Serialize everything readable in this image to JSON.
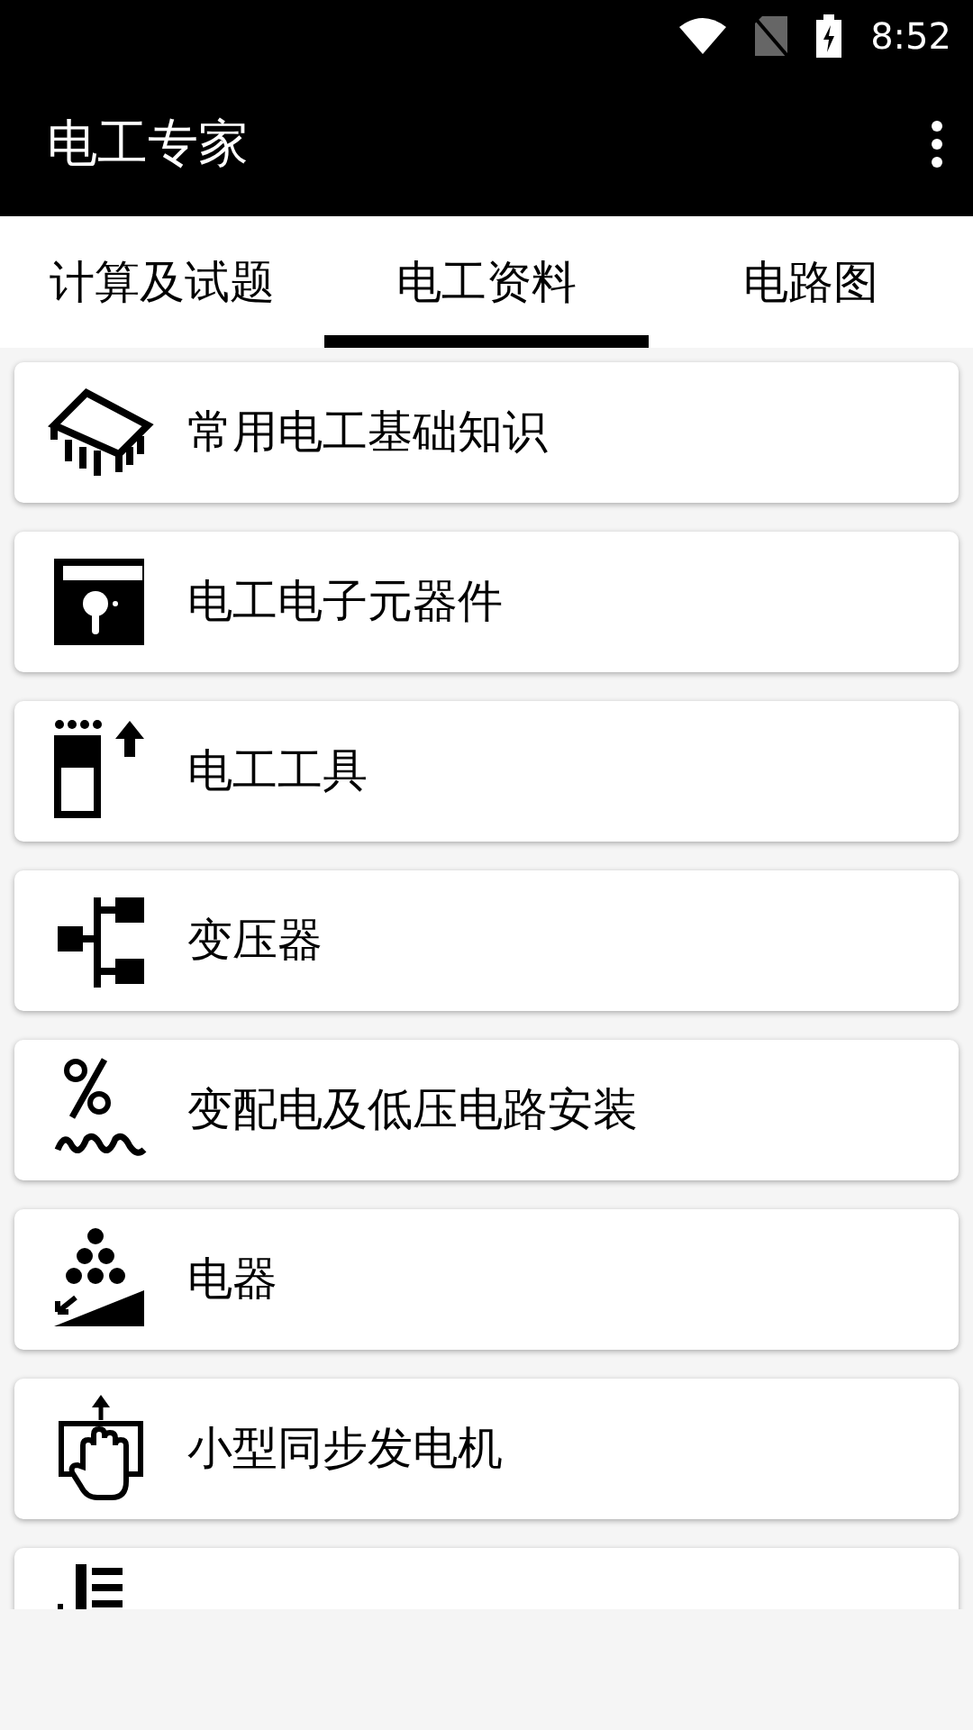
{
  "status_bar": {
    "time": "8:52"
  },
  "app_bar": {
    "title": "电工专家"
  },
  "tabs": [
    {
      "label": "计算及试题",
      "selected": false
    },
    {
      "label": "电工资料",
      "selected": true
    },
    {
      "label": "电路图",
      "selected": false
    }
  ],
  "items": [
    {
      "kind": "entry",
      "label": "常用电工基础知识"
    },
    {
      "kind": "entry",
      "label": "电工电子元器件"
    },
    {
      "kind": "entry",
      "label": "电工工具"
    },
    {
      "kind": "entry",
      "label": "变压器"
    },
    {
      "kind": "entry",
      "label": "变配电及低压电路安装"
    },
    {
      "kind": "entry",
      "label": "电器"
    },
    {
      "kind": "entry",
      "label": "小型同步发电机"
    },
    {
      "kind": "cut"
    }
  ]
}
